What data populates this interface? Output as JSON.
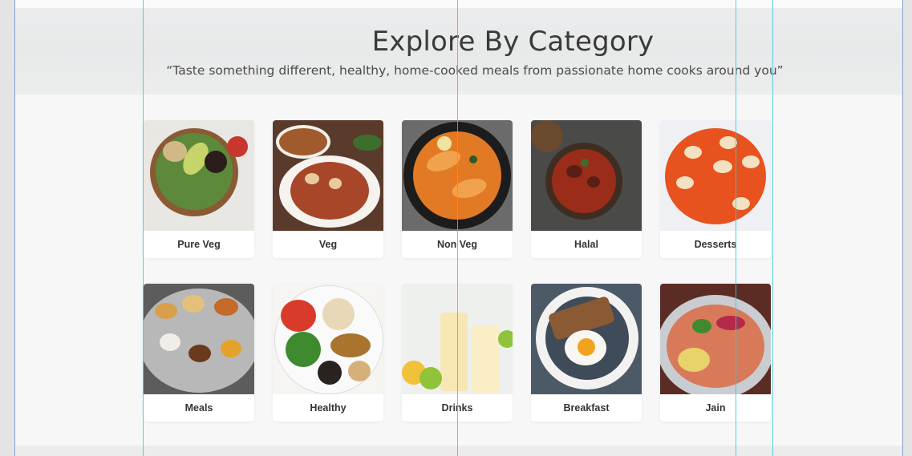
{
  "hero": {
    "title": "Explore By Category",
    "subtitle": "“Taste something different, healthy, home-cooked meals from passionate home cooks around you”"
  },
  "categories": [
    {
      "label": "Pure Veg",
      "icon": "salad-bowl-image"
    },
    {
      "label": "Veg",
      "icon": "paneer-curry-image"
    },
    {
      "label": "Non Veg",
      "icon": "fish-curry-image"
    },
    {
      "label": "Halal",
      "icon": "meat-curry-image"
    },
    {
      "label": "Desserts",
      "icon": "halwa-image"
    },
    {
      "label": "Meals",
      "icon": "thali-image"
    },
    {
      "label": "Healthy",
      "icon": "healthy-plate-image"
    },
    {
      "label": "Drinks",
      "icon": "lemonade-image"
    },
    {
      "label": "Breakfast",
      "icon": "egg-toast-image"
    },
    {
      "label": "Jain",
      "icon": "noodle-salad-image"
    }
  ],
  "colors": {
    "guide": "#3cc8d0",
    "frame_border": "#7fa3cf"
  }
}
